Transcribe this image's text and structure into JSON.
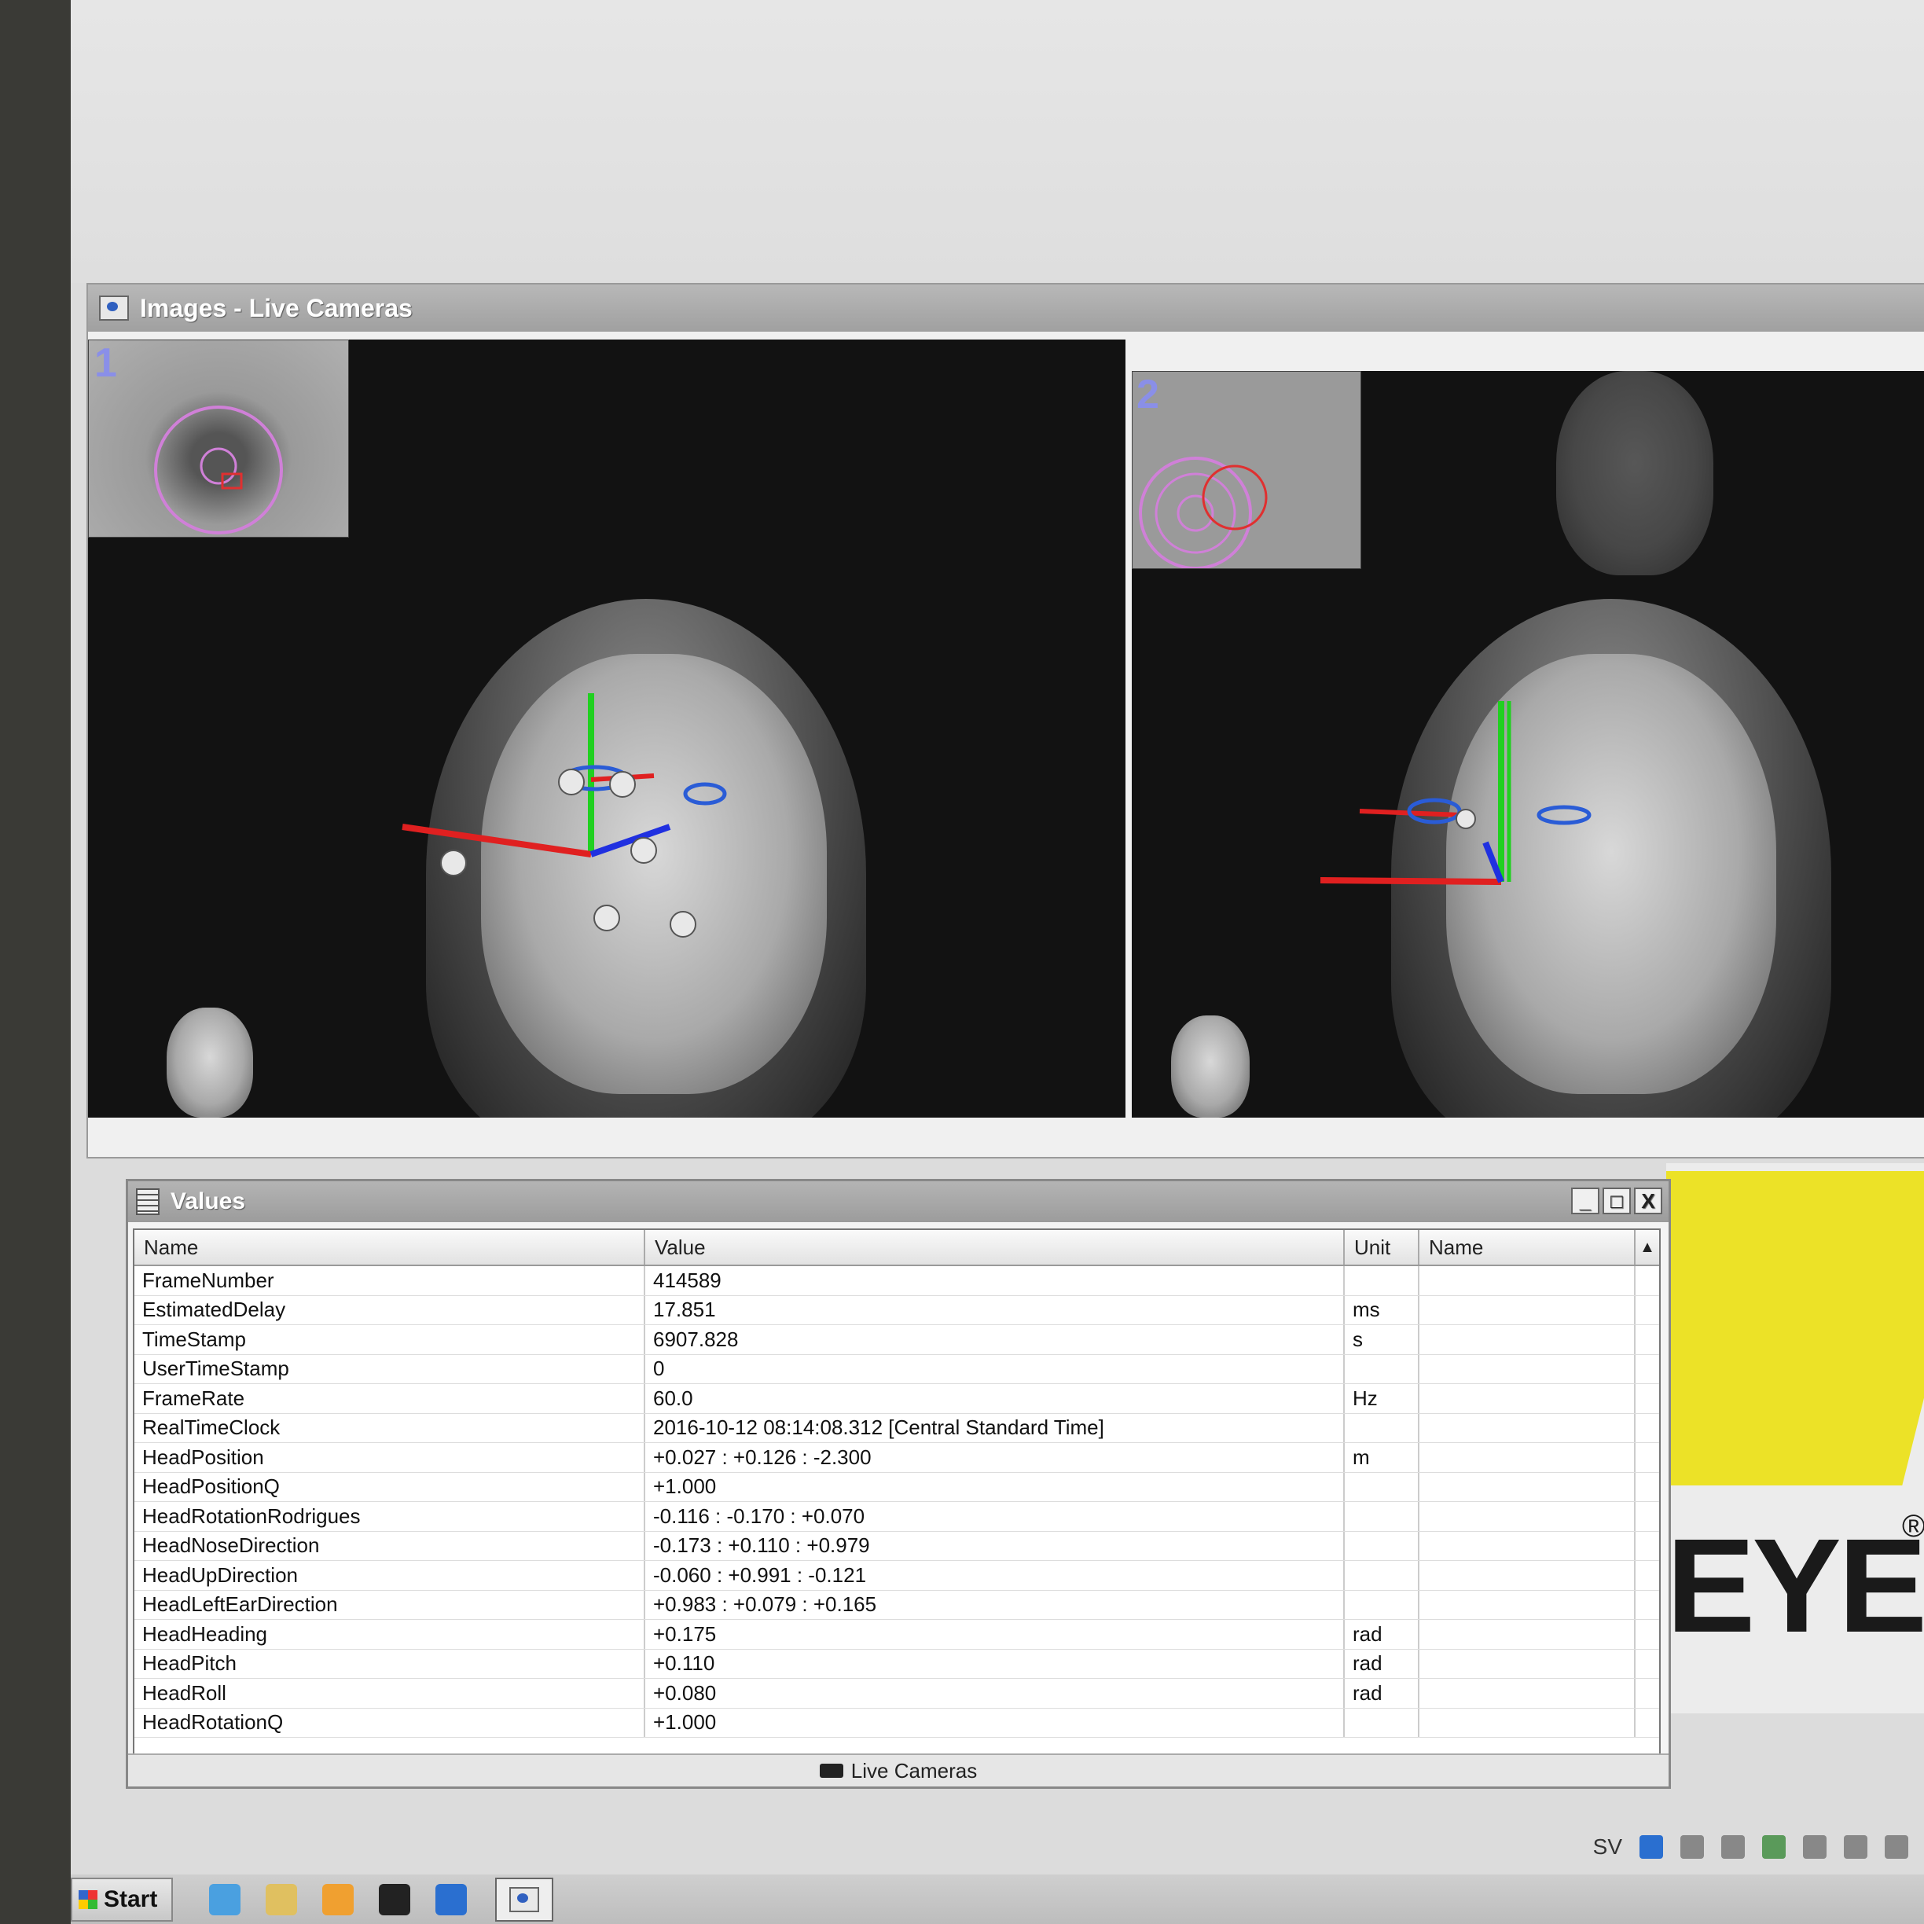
{
  "images_window": {
    "title": "Images - Live Cameras",
    "camera1_label": "1",
    "camera2_label": "2"
  },
  "values_window": {
    "title": "Values",
    "buttons": {
      "minimize": "_",
      "maximize": "□",
      "close": "X"
    },
    "columns": [
      "Name",
      "Value",
      "Unit",
      "Name"
    ],
    "rows": [
      {
        "name": "FrameNumber",
        "value": "414589",
        "unit": "",
        "alias": ""
      },
      {
        "name": "EstimatedDelay",
        "value": "17.851",
        "unit": "ms",
        "alias": ""
      },
      {
        "name": "TimeStamp",
        "value": "6907.828",
        "unit": "s",
        "alias": ""
      },
      {
        "name": "UserTimeStamp",
        "value": "0",
        "unit": "",
        "alias": ""
      },
      {
        "name": "FrameRate",
        "value": "60.0",
        "unit": "Hz",
        "alias": ""
      },
      {
        "name": "RealTimeClock",
        "value": "2016-10-12 08:14:08.312 [Central Standard Time]",
        "unit": "",
        "alias": ""
      },
      {
        "name": "HeadPosition",
        "value": "+0.027 : +0.126 : -2.300",
        "unit": "m",
        "alias": ""
      },
      {
        "name": "HeadPositionQ",
        "value": "+1.000",
        "unit": "",
        "alias": ""
      },
      {
        "name": "HeadRotationRodrigues",
        "value": "-0.116 : -0.170 : +0.070",
        "unit": "",
        "alias": ""
      },
      {
        "name": "HeadNoseDirection",
        "value": "-0.173 : +0.110 : +0.979",
        "unit": "",
        "alias": ""
      },
      {
        "name": "HeadUpDirection",
        "value": "-0.060 : +0.991 : -0.121",
        "unit": "",
        "alias": ""
      },
      {
        "name": "HeadLeftEarDirection",
        "value": "+0.983 : +0.079 : +0.165",
        "unit": "",
        "alias": ""
      },
      {
        "name": "HeadHeading",
        "value": "+0.175",
        "unit": "rad",
        "alias": ""
      },
      {
        "name": "HeadPitch",
        "value": "+0.110",
        "unit": "rad",
        "alias": ""
      },
      {
        "name": "HeadRoll",
        "value": "+0.080",
        "unit": "rad",
        "alias": ""
      },
      {
        "name": "HeadRotationQ",
        "value": "+1.000",
        "unit": "",
        "alias": ""
      }
    ],
    "status": "Live Cameras"
  },
  "logo": {
    "text": "EYE",
    "registered": "®",
    "color": "#ece227"
  },
  "tray": {
    "language": "SV"
  },
  "taskbar": {
    "start_label": "Start"
  },
  "colors": {
    "axis_x": "#e02020",
    "axis_y": "#20d020",
    "axis_z": "#2030e0",
    "eye_overlay": "#2a5cd6",
    "gaze_circle": "#d080d8"
  }
}
